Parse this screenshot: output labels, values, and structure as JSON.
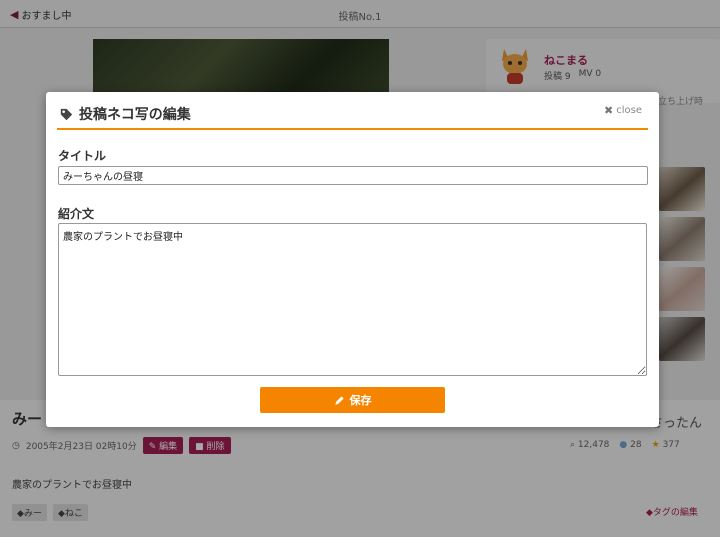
{
  "topbar": {
    "back_label": "おすまし中",
    "title": "投稿No.1"
  },
  "profile": {
    "name": "ねこまる",
    "posts": "投稿 9",
    "mv": "MV 0",
    "side_text": "立ち上げ時"
  },
  "post": {
    "title": "みー",
    "author": "さったん",
    "date": "2005年2月23日 02時10分",
    "edit_label": "編集",
    "delete_label": "削除",
    "views": "12,478",
    "comments": "28",
    "stars": "377",
    "description": "農家のプラントでお昼寝中",
    "tags": [
      "みー",
      "ねこ"
    ],
    "tag_edit_label": "タグの編集"
  },
  "modal": {
    "title": "投稿ネコ写の編集",
    "close_label": "close",
    "title_field_label": "タイトル",
    "title_value": "みーちゃんの昼寝",
    "desc_field_label": "紹介文",
    "desc_value": "農家のプラントでお昼寝中",
    "save_label": "保存"
  },
  "colors": {
    "accent": "#f58500",
    "brand": "#a51f56",
    "rule": "#f08a00"
  }
}
